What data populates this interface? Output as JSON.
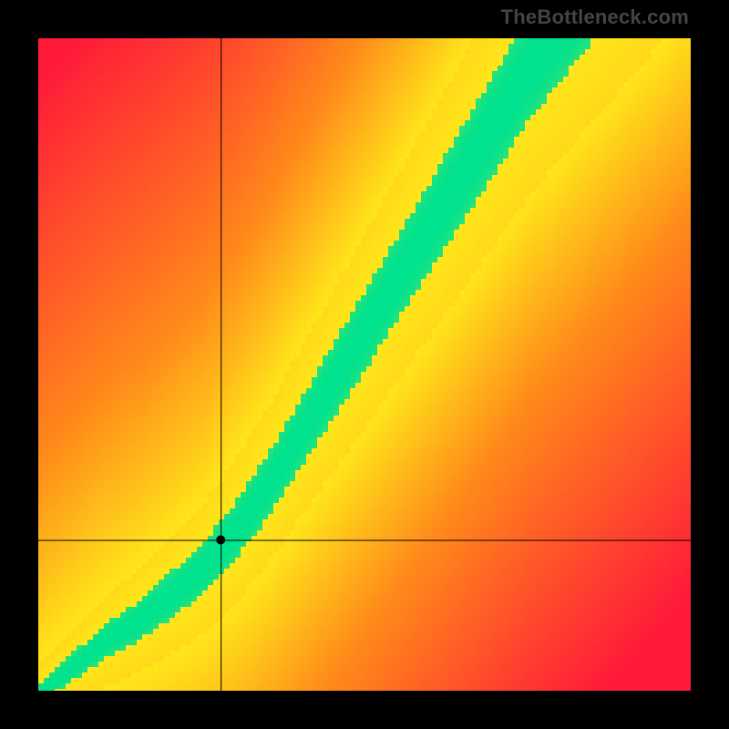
{
  "watermark": "TheBottleneck.com",
  "chart_data": {
    "type": "heatmap",
    "title": "",
    "xlabel": "",
    "ylabel": "",
    "xlim": [
      0,
      1
    ],
    "ylim": [
      0,
      1
    ],
    "crosshair": {
      "x": 0.28,
      "y": 0.23
    },
    "ridge": {
      "description": "curved green optimal band from bottom-left to top-right",
      "points": [
        {
          "x": 0.0,
          "y": 0.0
        },
        {
          "x": 0.05,
          "y": 0.04
        },
        {
          "x": 0.1,
          "y": 0.08
        },
        {
          "x": 0.15,
          "y": 0.11
        },
        {
          "x": 0.2,
          "y": 0.15
        },
        {
          "x": 0.25,
          "y": 0.19
        },
        {
          "x": 0.3,
          "y": 0.25
        },
        {
          "x": 0.35,
          "y": 0.32
        },
        {
          "x": 0.4,
          "y": 0.4
        },
        {
          "x": 0.45,
          "y": 0.48
        },
        {
          "x": 0.5,
          "y": 0.56
        },
        {
          "x": 0.55,
          "y": 0.64
        },
        {
          "x": 0.6,
          "y": 0.72
        },
        {
          "x": 0.65,
          "y": 0.8
        },
        {
          "x": 0.7,
          "y": 0.88
        },
        {
          "x": 0.75,
          "y": 0.96
        },
        {
          "x": 0.78,
          "y": 1.0
        }
      ],
      "width_start": 0.015,
      "width_end": 0.1
    },
    "colors": {
      "far": "#ff1a3a",
      "mid_warm": "#ff8a1a",
      "near": "#ffe61a",
      "on": "#00e28f"
    }
  }
}
